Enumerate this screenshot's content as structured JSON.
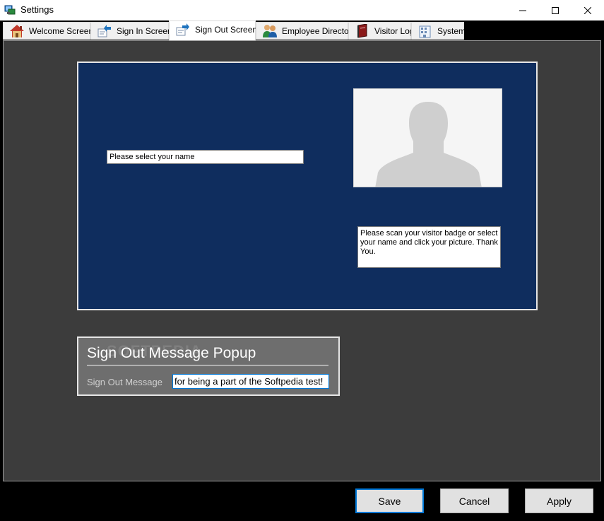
{
  "window": {
    "title": "Settings"
  },
  "tabs": [
    {
      "label": "Welcome Screen",
      "icon": "house-icon",
      "active": false
    },
    {
      "label": "Sign In Screen",
      "icon": "sign-in-icon",
      "active": false
    },
    {
      "label": "Sign Out Screen",
      "icon": "sign-out-icon",
      "active": true
    },
    {
      "label": "Employee Directory",
      "icon": "people-icon",
      "active": false
    },
    {
      "label": "Visitor Log",
      "icon": "book-icon",
      "active": false
    },
    {
      "label": "System",
      "icon": "building-icon",
      "active": false
    }
  ],
  "preview": {
    "name_placeholder": "Please select your name",
    "instructions": "Please scan your visitor badge or select your name and click your picture. Thank You.",
    "photo_icon": "person-silhouette-icon",
    "background_color": "#0f2d5e"
  },
  "popup": {
    "title": "Sign Out Message Popup",
    "message_label": "Sign Out Message",
    "message_value": "for being a part of the Softpedia test!",
    "watermark": "SOFTPEDIA"
  },
  "buttons": {
    "save": "Save",
    "cancel": "Cancel",
    "apply": "Apply"
  },
  "colors": {
    "accent": "#0078d7",
    "content_bg": "#3c3c3c"
  }
}
